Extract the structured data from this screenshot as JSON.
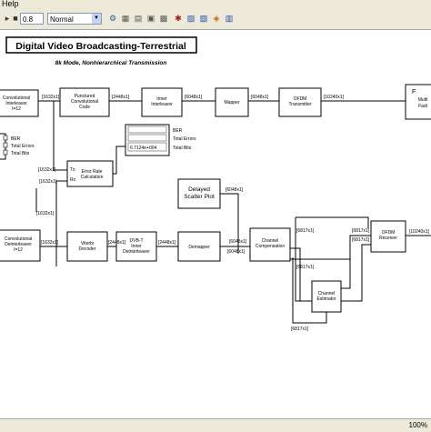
{
  "menubar": {
    "help_label": "Help"
  },
  "toolbar": {
    "stop_time": "0.8",
    "sim_mode": "Normal",
    "icons": [
      "new-icon",
      "open-icon",
      "save-icon",
      "print-icon",
      "cut-icon",
      "copy-icon",
      "paste-icon",
      "undo-icon",
      "redo-icon",
      "play-icon",
      "pause-icon",
      "stop-icon",
      "build-icon",
      "library-icon",
      "explorer-icon",
      "debug-icon",
      "config-icon"
    ]
  },
  "diagram": {
    "title": "Digital Video Broadcasting-Terrestrial",
    "subtitle": "8k Mode, Nonhierarchical Transmission",
    "blocks": {
      "conv_interleaver": [
        "Convolutional",
        "Interleaver",
        "I=12"
      ],
      "punctured_code": [
        "Punctured",
        "Convolutional",
        "Code"
      ],
      "inner_interleaver": [
        "Inner",
        "Interleaver"
      ],
      "mapper": [
        "Mapper"
      ],
      "ofdm_tx": [
        "OFDM",
        "Transmitter"
      ],
      "multipath": [
        "Multi",
        "Fadi"
      ],
      "ber_display": {
        "ber": "BER",
        "errors": "Total Errors",
        "bits": "Total Bits"
      },
      "error_rate": [
        "Error Rate",
        "Calculation"
      ],
      "error_rate_tx": "Tx",
      "error_rate_rx": "Rx",
      "display_value": "6.7124e+004",
      "display_labels": [
        "BER",
        "Total Errors",
        "Total Bits"
      ],
      "delayed_scatter": [
        "Delayed",
        "Scatter Plot"
      ],
      "conv_deinterleaver": [
        "Convolutional",
        "Deinterleaver",
        "I=12"
      ],
      "viterbi": [
        "Viterbi",
        "Decoder"
      ],
      "inner_deinterleaver": [
        "DVB-T",
        "Inner",
        "Deinterleaver"
      ],
      "demapper": [
        "Demapper"
      ],
      "channel_comp": [
        "Channel",
        "Compensation"
      ],
      "channel_est": [
        "Channel",
        "Estimator"
      ],
      "ofdm_rx": [
        "OFDM",
        "Receiver"
      ]
    },
    "signals": {
      "s1": "[1632x1]",
      "s2": "[2448x1]",
      "s3": "[2448x1]",
      "s4": "[6048x1]",
      "s5": "[6048x1]",
      "s6": "[10240x1]",
      "s7": "[1632x1]",
      "s8": "[1632x1]",
      "s9": "[2448x1]",
      "s10": "[2448x1]",
      "s11": "[6048x1]",
      "s12": "[6048x1]",
      "s13": "[6817x1]",
      "s14": "[6817x1]",
      "s15": "[6817x1]",
      "s16": "[6817x1]",
      "s17": "[6817x1]",
      "s18": "[10240x1]",
      "s19": "[1632x1]",
      "s20": "[1632x1]",
      "s21": "[6048x1]"
    }
  },
  "status": {
    "zoom": "100%"
  }
}
